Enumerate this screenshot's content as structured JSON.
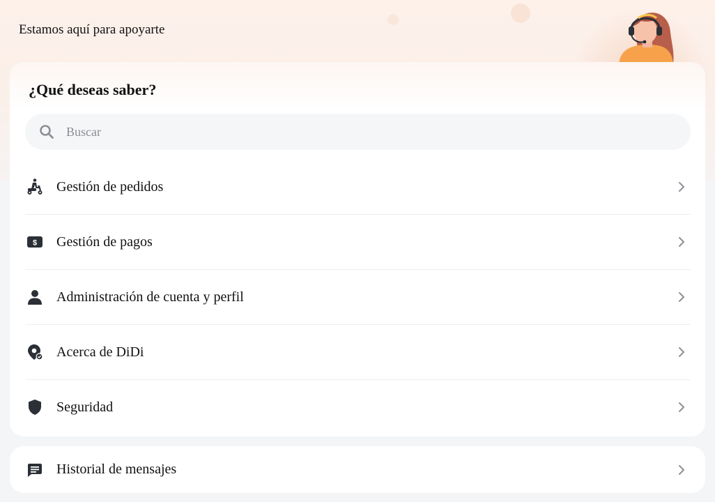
{
  "header": {
    "tagline": "Estamos aquí para apoyarte",
    "avatar_icon": "support-agent-headset-avatar"
  },
  "help": {
    "title": "¿Qué deseas saber?",
    "search": {
      "placeholder": "Buscar",
      "value": ""
    },
    "items": [
      {
        "label": "Gestión de pedidos",
        "icon": "delivery-scooter-icon"
      },
      {
        "label": "Gestión de pagos",
        "icon": "dollar-bill-icon"
      },
      {
        "label": "Administración de cuenta y perfil",
        "icon": "user-icon"
      },
      {
        "label": "Acerca de DiDi",
        "icon": "location-pin-icon"
      },
      {
        "label": "Seguridad",
        "icon": "shield-icon"
      }
    ]
  },
  "history": {
    "label": "Historial de mensajes",
    "icon": "message-icon"
  },
  "colors": {
    "accent": "#f7a24b",
    "icon": "#2b2f36",
    "chevron": "#8c9096",
    "background": "#f4f5f7"
  }
}
